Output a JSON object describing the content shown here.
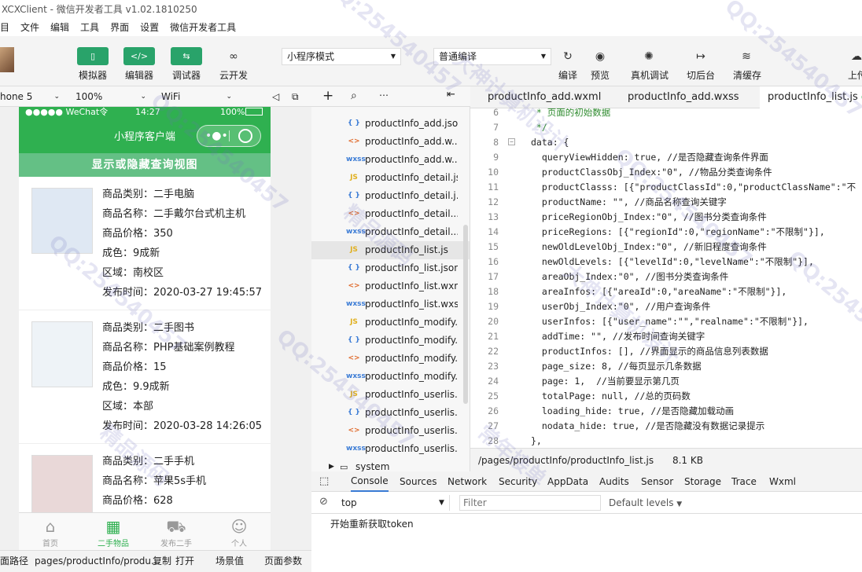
{
  "window": {
    "title": "XCXClient - 微信开发者工具 v1.02.1810250"
  },
  "menu": [
    "目",
    "文件",
    "编辑",
    "工具",
    "界面",
    "设置",
    "微信开发者工具"
  ],
  "toolbar": {
    "simulator": "模拟器",
    "editor": "编辑器",
    "debugger": "调试器",
    "cloud": "云开发",
    "mode": "小程序模式",
    "compile_mode": "普通编译",
    "compile": "编译",
    "preview": "预览",
    "real_debug": "真机调试",
    "background": "切后台",
    "clear_cache": "清缓存",
    "upload": "上传"
  },
  "simulator_bar": {
    "device": "hone 5",
    "zoom": "100%",
    "network": "WiFi"
  },
  "phone": {
    "status": {
      "carrier": "●●●●● WeChat令",
      "time": "14:27",
      "battery": "100%"
    },
    "nav_title": "小程序客户端",
    "toggle_label": "显示或隐藏查询视图",
    "products": [
      {
        "category": "商品类别：二手电脑",
        "name": "商品名称：二手戴尔台式机主机",
        "price": "商品价格：350",
        "condition": "成色：9成新",
        "area": "区域：南校区",
        "time": "发布时间：2020-03-27 19:45:57"
      },
      {
        "category": "商品类别：二手图书",
        "name": "商品名称：PHP基础案例教程",
        "price": "商品价格：15",
        "condition": "成色：9.9成新",
        "area": "区域：本部",
        "time": "发布时间：2020-03-28 14:26:05"
      },
      {
        "category": "商品类别：二手手机",
        "name": "商品名称：苹果5s手机",
        "price": "商品价格：628"
      }
    ],
    "tabs": [
      "首页",
      "二手物品",
      "发布二手",
      "个人"
    ]
  },
  "bottom_bar": {
    "path_label": "面路径",
    "path": "pages/productInfo/produ...",
    "copy": "复制",
    "open": "打开",
    "scene": "场景值",
    "params": "页面参数"
  },
  "file_tree": [
    {
      "icon": "{ }",
      "color": "#3a7bd5",
      "name": "productInfo_add.json"
    },
    {
      "icon": "<>",
      "color": "#e06c2e",
      "name": "productInfo_add.w..."
    },
    {
      "icon": "wxss",
      "color": "#3a7bd5",
      "name": "productInfo_add.w..."
    },
    {
      "icon": "JS",
      "color": "#e0b020",
      "name": "productInfo_detail.js"
    },
    {
      "icon": "{ }",
      "color": "#3a7bd5",
      "name": "productInfo_detail.j..."
    },
    {
      "icon": "<>",
      "color": "#e06c2e",
      "name": "productInfo_detail...."
    },
    {
      "icon": "wxss",
      "color": "#3a7bd5",
      "name": "productInfo_detail...."
    },
    {
      "icon": "JS",
      "color": "#e0b020",
      "name": "productInfo_list.js"
    },
    {
      "icon": "{ }",
      "color": "#3a7bd5",
      "name": "productInfo_list.json"
    },
    {
      "icon": "<>",
      "color": "#e06c2e",
      "name": "productInfo_list.wxml"
    },
    {
      "icon": "wxss",
      "color": "#3a7bd5",
      "name": "productInfo_list.wxss"
    },
    {
      "icon": "JS",
      "color": "#e0b020",
      "name": "productInfo_modify.js"
    },
    {
      "icon": "{ }",
      "color": "#3a7bd5",
      "name": "productInfo_modify..."
    },
    {
      "icon": "<>",
      "color": "#e06c2e",
      "name": "productInfo_modify..."
    },
    {
      "icon": "wxss",
      "color": "#3a7bd5",
      "name": "productInfo_modify..."
    },
    {
      "icon": "JS",
      "color": "#e0b020",
      "name": "productInfo_userlis..."
    },
    {
      "icon": "{ }",
      "color": "#3a7bd5",
      "name": "productInfo_userlis..."
    },
    {
      "icon": "<>",
      "color": "#e06c2e",
      "name": "productInfo_userlis..."
    },
    {
      "icon": "wxss",
      "color": "#3a7bd5",
      "name": "productInfo_userlis..."
    }
  ],
  "file_tree_folder": "system",
  "editor_tabs": [
    "productInfo_add.wxml",
    "productInfo_add.wxss",
    "productInfo_list.js"
  ],
  "code_lines": [
    {
      "n": "6",
      "t": " * 页面的初始数据"
    },
    {
      "n": "7",
      "t": " */"
    },
    {
      "n": "8",
      "t": "data: {"
    },
    {
      "n": "9",
      "t": "  queryViewHidden: true, //是否隐藏查询条件界面"
    },
    {
      "n": "10",
      "t": "  productClassObj_Index:\"0\", //物品分类查询条件"
    },
    {
      "n": "11",
      "t": "  productClasss: [{\"productClassId\":0,\"productClassName\":\"不"
    },
    {
      "n": "12",
      "t": "  productName: \"\", //商品名称查询关键字"
    },
    {
      "n": "13",
      "t": "  priceRegionObj_Index:\"0\", //图书分类查询条件"
    },
    {
      "n": "14",
      "t": "  priceRegions: [{\"regionId\":0,\"regionName\":\"不限制\"}],"
    },
    {
      "n": "15",
      "t": "  newOldLevelObj_Index:\"0\", //新旧程度查询条件"
    },
    {
      "n": "16",
      "t": "  newOldLevels: [{\"levelId\":0,\"levelName\":\"不限制\"}],"
    },
    {
      "n": "17",
      "t": "  areaObj_Index:\"0\", //图书分类查询条件"
    },
    {
      "n": "18",
      "t": "  areaInfos: [{\"areaId\":0,\"areaName\":\"不限制\"}],"
    },
    {
      "n": "19",
      "t": "  userObj_Index:\"0\", //用户查询条件"
    },
    {
      "n": "20",
      "t": "  userInfos: [{\"user_name\":\"\",\"realname\":\"不限制\"}],"
    },
    {
      "n": "21",
      "t": "  addTime: \"\", //发布时间查询关键字"
    },
    {
      "n": "22",
      "t": "  productInfos: [], //界面显示的商品信息列表数据"
    },
    {
      "n": "23",
      "t": "  page_size: 8, //每页显示几条数据"
    },
    {
      "n": "24",
      "t": "  page: 1,  //当前要显示第几页"
    },
    {
      "n": "25",
      "t": "  totalPage: null, //总的页码数"
    },
    {
      "n": "26",
      "t": "  loading_hide: true, //是否隐藏加载动画"
    },
    {
      "n": "27",
      "t": "  nodata_hide: true, //是否隐藏没有数据记录提示"
    },
    {
      "n": "28",
      "t": "},"
    }
  ],
  "status_path": "/pages/productInfo/productInfo_list.js",
  "status_size": "8.1 KB",
  "devtools_tabs": [
    "Console",
    "Sources",
    "Network",
    "Security",
    "AppData",
    "Audits",
    "Sensor",
    "Storage",
    "Trace",
    "Wxml"
  ],
  "console": {
    "context": "top",
    "filter_placeholder": "Filter",
    "levels": "Default levels",
    "message": "开始重新获取token"
  },
  "watermark": [
    "QQ:254540457",
    "常年接单",
    "大神计算机设计",
    "精品源码"
  ]
}
